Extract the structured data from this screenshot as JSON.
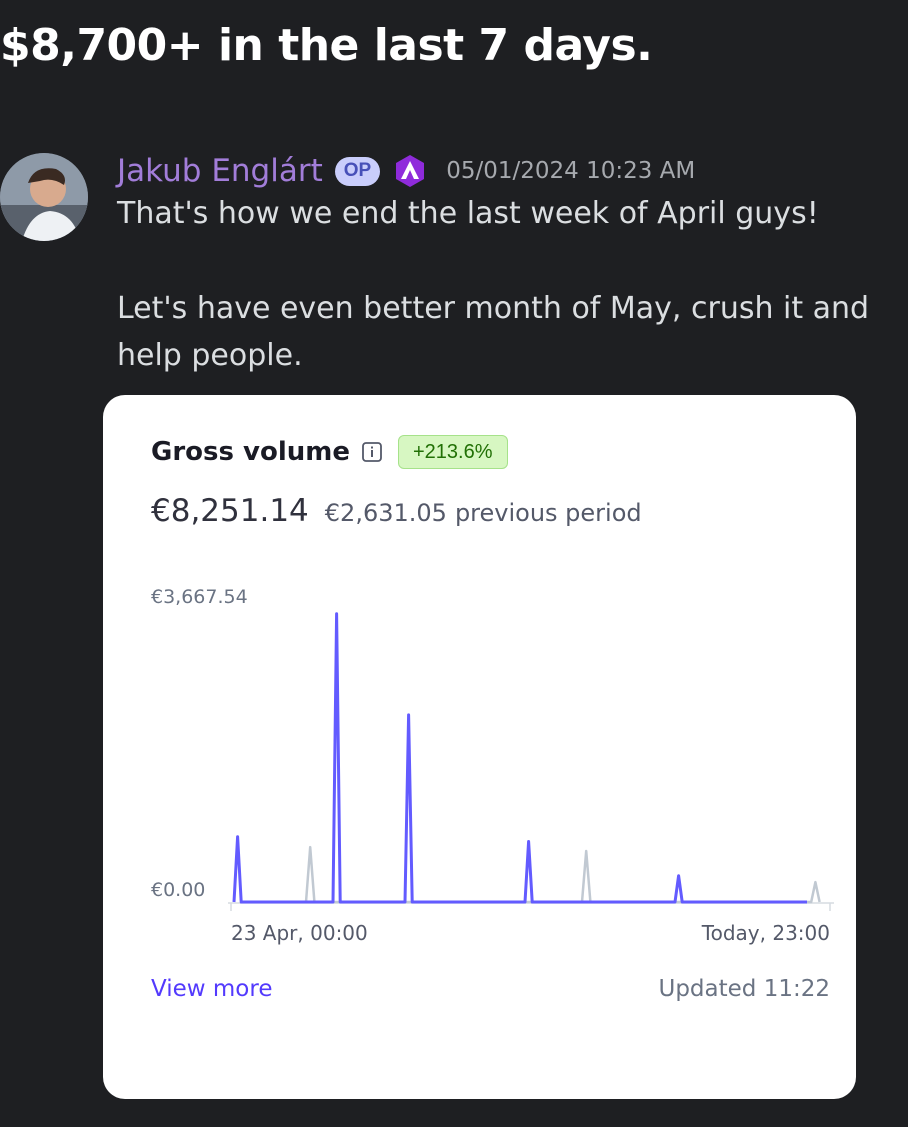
{
  "post": {
    "title": "$8,700+ in the last 7 days."
  },
  "message": {
    "author": "Jakub Englárt",
    "op_badge": "OP",
    "role_icon": "triangle-a-icon",
    "timestamp": "05/01/2024 10:23 AM",
    "lines": [
      "That's how we end the last week of April guys!",
      "Let's have even better month of May, crush it and",
      "help people."
    ],
    "author_color": "#a27dd9"
  },
  "card": {
    "title": "Gross volume",
    "info_icon": "info-icon",
    "change": "+213.6%",
    "amount": "€8,251.14",
    "previous_amount": "€2,631.05",
    "previous_label": "previous period",
    "view_more": "View more",
    "updated": "Updated 11:22"
  },
  "chart_data": {
    "type": "line",
    "title": "",
    "y_tick_labels": [
      "€3,667.54",
      "€0.00"
    ],
    "ylim": [
      0,
      3667.54
    ],
    "x_tick_labels": [
      "23 Apr, 00:00",
      "Today, 23:00"
    ],
    "series": [
      {
        "role": "current period",
        "color": "#635bff",
        "points": [
          {
            "t": 0.01,
            "value": 0
          },
          {
            "t": 0.016,
            "value": 820
          },
          {
            "t": 0.022,
            "value": 0
          },
          {
            "t": 0.175,
            "value": 0
          },
          {
            "t": 0.181,
            "value": 3620
          },
          {
            "t": 0.187,
            "value": 0
          },
          {
            "t": 0.295,
            "value": 0
          },
          {
            "t": 0.301,
            "value": 2350
          },
          {
            "t": 0.307,
            "value": 0
          },
          {
            "t": 0.495,
            "value": 0
          },
          {
            "t": 0.501,
            "value": 760
          },
          {
            "t": 0.507,
            "value": 0
          },
          {
            "t": 0.745,
            "value": 0
          },
          {
            "t": 0.751,
            "value": 330
          },
          {
            "t": 0.757,
            "value": 0
          },
          {
            "t": 0.965,
            "value": 0
          }
        ]
      },
      {
        "role": "previous period",
        "color": "#c1c9d2",
        "points": [
          {
            "t": 0.13,
            "value": 0
          },
          {
            "t": 0.137,
            "value": 690
          },
          {
            "t": 0.144,
            "value": 0
          },
          {
            "t": 0.59,
            "value": 0
          },
          {
            "t": 0.597,
            "value": 640
          },
          {
            "t": 0.604,
            "value": 0
          },
          {
            "t": 0.972,
            "value": 0
          },
          {
            "t": 0.979,
            "value": 250
          },
          {
            "t": 0.986,
            "value": 0
          }
        ]
      }
    ]
  }
}
